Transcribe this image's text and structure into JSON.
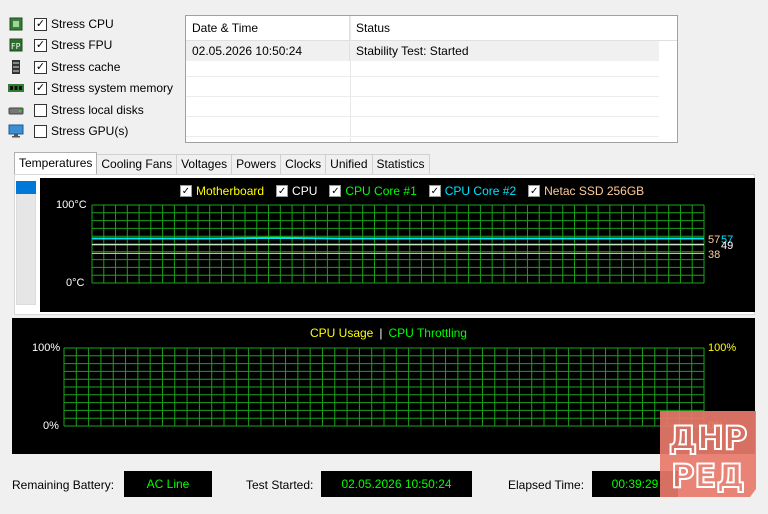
{
  "stress": [
    {
      "label": "Stress CPU",
      "checked": true,
      "icon": "cpu-chip-icon"
    },
    {
      "label": "Stress FPU",
      "checked": true,
      "icon": "fpu-chip-icon"
    },
    {
      "label": "Stress cache",
      "checked": true,
      "icon": "cache-icon"
    },
    {
      "label": "Stress system memory",
      "checked": true,
      "icon": "memory-module-icon"
    },
    {
      "label": "Stress local disks",
      "checked": false,
      "icon": "disk-drive-icon"
    },
    {
      "label": "Stress GPU(s)",
      "checked": false,
      "icon": "monitor-icon"
    }
  ],
  "log": {
    "headers": [
      "Date & Time",
      "Status"
    ],
    "rows": [
      {
        "datetime": "02.05.2026 10:50:24",
        "status": "Stability Test: Started"
      }
    ]
  },
  "tabs": [
    "Temperatures",
    "Cooling Fans",
    "Voltages",
    "Powers",
    "Clocks",
    "Unified",
    "Statistics"
  ],
  "active_tab": "Temperatures",
  "temp_chart": {
    "legend": [
      {
        "name": "Motherboard",
        "color": "#ffff00"
      },
      {
        "name": "CPU",
        "color": "#ffffff"
      },
      {
        "name": "CPU Core #1",
        "color": "#00ff00"
      },
      {
        "name": "CPU Core #2",
        "color": "#00e5ff"
      },
      {
        "name": "Netac SSD 256GB",
        "color": "#ffcc99"
      }
    ],
    "y_max_label": "100°C",
    "y_min_label": "0°C",
    "right_values": {
      "a": "57",
      "b": "57",
      "c": "49",
      "d": "38"
    }
  },
  "cpu_chart": {
    "legend_usage": "CPU Usage",
    "legend_sep": "|",
    "legend_throttling": "CPU Throttling",
    "y_max_left": "100%",
    "y_min_left": "0%",
    "y_max_right": "100%",
    "y_min_right": "0%"
  },
  "status": {
    "battery_label": "Remaining Battery:",
    "battery_value": "AC Line",
    "started_label": "Test Started:",
    "started_value": "02.05.2026 10:50:24",
    "elapsed_label": "Elapsed Time:",
    "elapsed_value": "00:39:29"
  },
  "watermark": {
    "line1": "ДНР",
    "line2": "РЕД"
  },
  "chart_data": [
    {
      "type": "line",
      "x": [
        0,
        10,
        20,
        30,
        40,
        50,
        60,
        70,
        80,
        90,
        100
      ],
      "series": [
        {
          "name": "CPU Core #1",
          "values": [
            57,
            57,
            57,
            58,
            57,
            57,
            57,
            57,
            57,
            57,
            57
          ]
        },
        {
          "name": "CPU Core #2",
          "values": [
            57,
            57,
            57,
            57,
            57,
            57,
            57,
            57,
            57,
            57,
            57
          ]
        },
        {
          "name": "CPU",
          "values": [
            49,
            49,
            49,
            49,
            49,
            49,
            49,
            49,
            49,
            49,
            49
          ]
        },
        {
          "name": "Netac SSD 256GB",
          "values": [
            38,
            38,
            38,
            38,
            38,
            38,
            38,
            38,
            38,
            38,
            38
          ]
        }
      ],
      "ylim": [
        0,
        100
      ],
      "grid": true
    },
    {
      "type": "line",
      "series": [
        {
          "name": "CPU Usage",
          "values": []
        },
        {
          "name": "CPU Throttling",
          "values": []
        }
      ],
      "ylim": [
        0,
        100
      ],
      "grid": true
    }
  ]
}
